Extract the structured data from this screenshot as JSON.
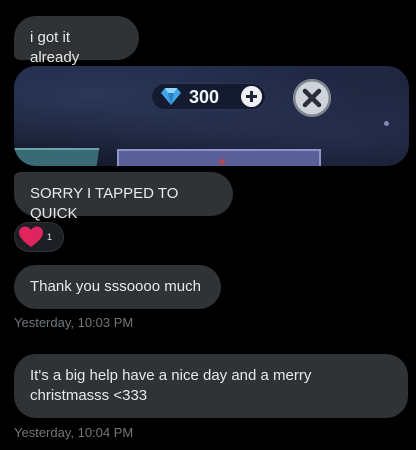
{
  "messages": [
    {
      "text": "i got it already"
    },
    {
      "text": "SORRY I TAPPED TO QUICK"
    },
    {
      "text": "Thank you sssoooo much"
    },
    {
      "text": "It's a big help have a nice day and a merry christmasss <333"
    }
  ],
  "media": {
    "gem_count": "300",
    "icons": [
      "gem-icon",
      "plus-icon",
      "close-icon"
    ]
  },
  "reaction": {
    "emoji": "heart-icon",
    "count": "1"
  },
  "timestamps": [
    "Yesterday, 10:03 PM",
    "Yesterday, 10:04 PM"
  ],
  "colors": {
    "background": "#000000",
    "bubble": "#2f3336",
    "text": "#e7e9ea",
    "timestamp": "#71767b",
    "heart": "#f91880"
  }
}
